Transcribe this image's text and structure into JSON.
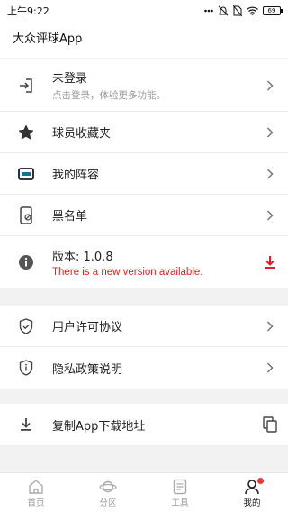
{
  "status_bar": {
    "time": "上午9:22",
    "battery": "69"
  },
  "app_title": "大众评球App",
  "section1": {
    "login": {
      "title": "未登录",
      "subtitle": "点击登录，体验更多功能。"
    },
    "favorites": {
      "label": "球员收藏夹"
    },
    "lineup": {
      "label": "我的阵容"
    },
    "blacklist": {
      "label": "黑名单"
    },
    "version": {
      "label": "版本: 1.0.8",
      "notice": "There is a new version available."
    }
  },
  "section2": {
    "license": {
      "label": "用户许可协议"
    },
    "privacy": {
      "label": "隐私政策说明"
    }
  },
  "section3": {
    "copy_link": {
      "label": "复制App下载地址"
    }
  },
  "tabbar": {
    "home": "首页",
    "category": "分区",
    "tools": "工具",
    "mine": "我的"
  },
  "colors": {
    "accent_red": "#e02020",
    "badge": "#e53935"
  }
}
